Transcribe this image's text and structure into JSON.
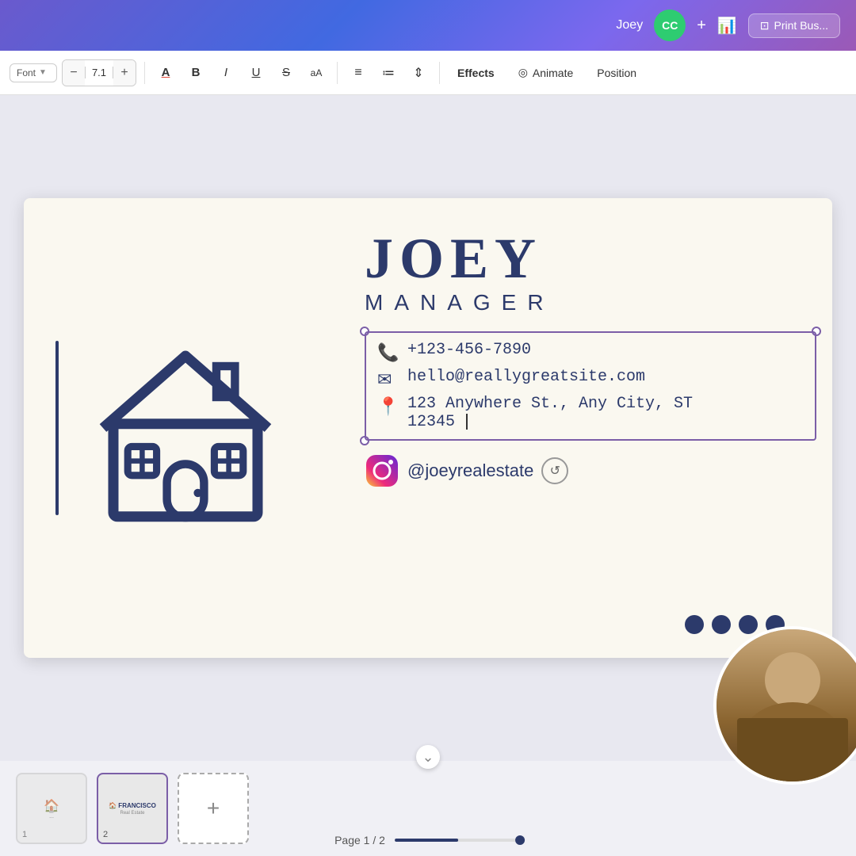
{
  "header": {
    "username": "Joey",
    "avatar_initials": "CC",
    "avatar_bg": "#2ecc71",
    "plus_label": "+",
    "print_label": "Print Bus...",
    "chart_icon": "📊"
  },
  "toolbar": {
    "font_dropdown_arrow": "▼",
    "font_size_minus": "−",
    "font_size_value": "7.1",
    "font_size_plus": "+",
    "font_color_btn": "A",
    "bold_btn": "B",
    "italic_btn": "I",
    "underline_btn": "U",
    "strikethrough_btn": "S",
    "case_btn": "aA",
    "align_btn": "≡",
    "list_btn": "≔",
    "spacing_btn": "⇕",
    "effects_btn": "Effects",
    "animate_btn": "Animate",
    "position_btn": "Position"
  },
  "canvas": {
    "background_color": "#faf8f0",
    "name": "JOEY",
    "role": "MANAGER",
    "phone": "+123-456-7890",
    "email": "hello@reallygreatsite.com",
    "address_line1": "123 Anywhere St., Any City, ST",
    "address_line2": "12345",
    "instagram_handle": "@joeyrealestate",
    "primary_color": "#2c3a6b",
    "accent_color": "#7b5ea7"
  },
  "pages": [
    {
      "number": "1",
      "label": "...",
      "active": false
    },
    {
      "number": "2",
      "label": "FRANCISCO",
      "active": true
    }
  ],
  "page_counter": {
    "label": "Page 1 / 2"
  },
  "add_page_btn": "+",
  "animate_icon": "◎",
  "print_icon": "⊡"
}
